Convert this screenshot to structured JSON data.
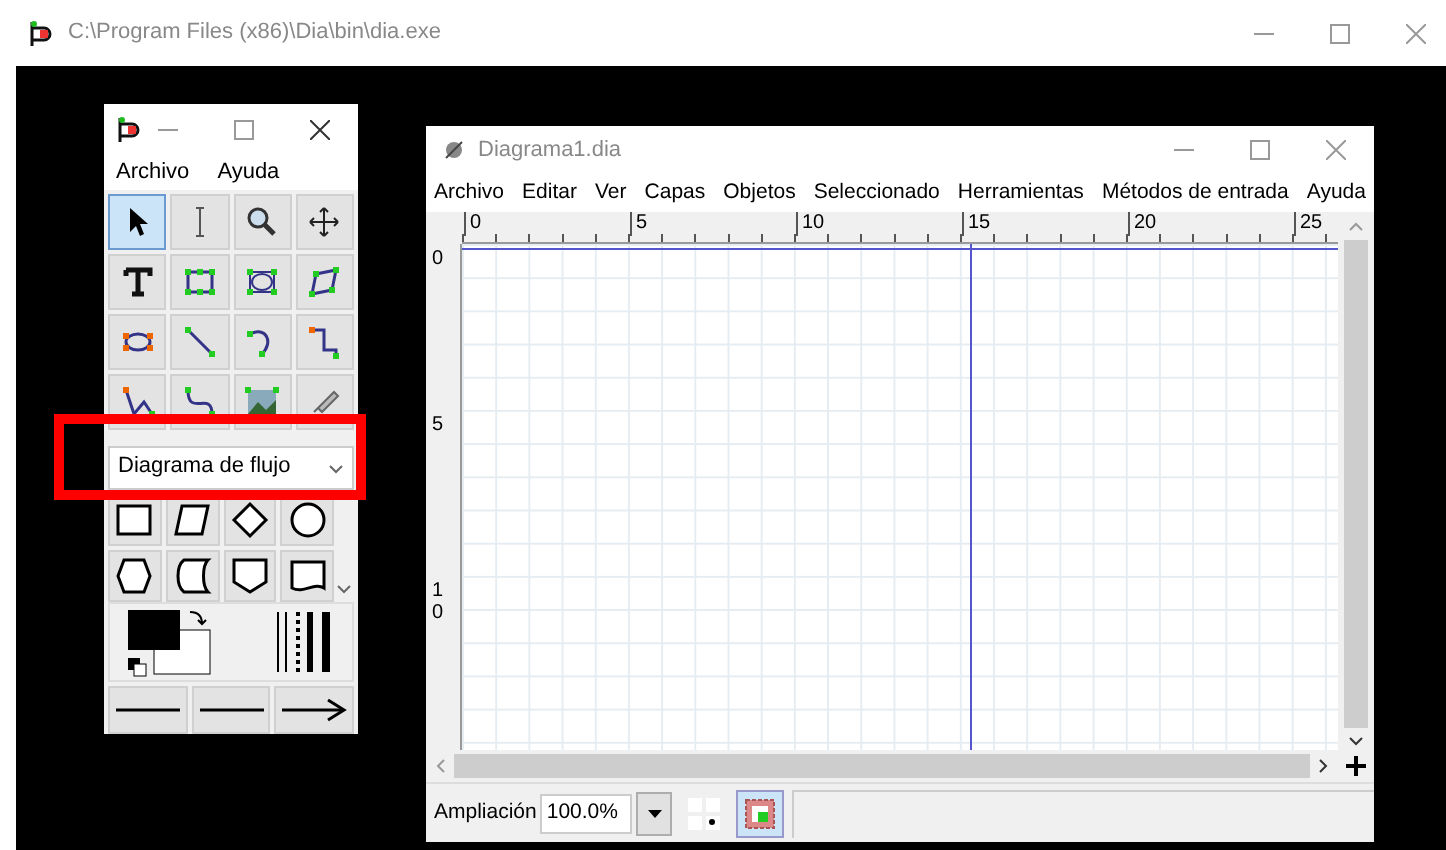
{
  "window": {
    "title": "C:\\Program Files (x86)\\Dia\\bin\\dia.exe"
  },
  "toolbox": {
    "menu": [
      "Archivo",
      "Ayuda"
    ],
    "tools": [
      {
        "kind": "pointer",
        "selected": true
      },
      {
        "kind": "text-edit",
        "selected": false
      },
      {
        "kind": "zoom",
        "selected": false
      },
      {
        "kind": "scroll",
        "selected": false
      },
      {
        "kind": "text",
        "selected": false
      },
      {
        "kind": "box",
        "selected": false
      },
      {
        "kind": "ellipse",
        "selected": false
      },
      {
        "kind": "polygon",
        "selected": false
      },
      {
        "kind": "beziergon",
        "selected": false
      },
      {
        "kind": "line",
        "selected": false
      },
      {
        "kind": "arc",
        "selected": false
      },
      {
        "kind": "zigzag",
        "selected": false
      },
      {
        "kind": "polyline",
        "selected": false
      },
      {
        "kind": "bezier",
        "selected": false
      },
      {
        "kind": "image",
        "selected": false
      },
      {
        "kind": "outline",
        "selected": false
      }
    ],
    "sheet": {
      "value": "Diagrama de flujo"
    },
    "shapes": [
      {
        "kind": "process"
      },
      {
        "kind": "input"
      },
      {
        "kind": "decision"
      },
      {
        "kind": "terminal"
      },
      {
        "kind": "preparation"
      },
      {
        "kind": "stored-data"
      },
      {
        "kind": "offpage"
      },
      {
        "kind": "document"
      }
    ],
    "lines": [
      {
        "kind": "plain"
      },
      {
        "kind": "plain"
      },
      {
        "kind": "arrow"
      }
    ]
  },
  "diagram": {
    "title": "Diagrama1.dia",
    "menu": [
      "Archivo",
      "Editar",
      "Ver",
      "Capas",
      "Objetos",
      "Seleccionado",
      "Herramientas",
      "Métodos de entrada",
      "Ayuda"
    ],
    "h_ruler": [
      "0",
      "5",
      "10",
      "15",
      "20",
      "25"
    ],
    "v_ruler": [
      "0",
      "5",
      "10"
    ],
    "zoom": {
      "label": "Ampliación",
      "value": "100.0%"
    },
    "toggles": [
      {
        "kind": "grid-snap",
        "selected": false
      },
      {
        "kind": "magnet",
        "selected": true
      }
    ]
  }
}
